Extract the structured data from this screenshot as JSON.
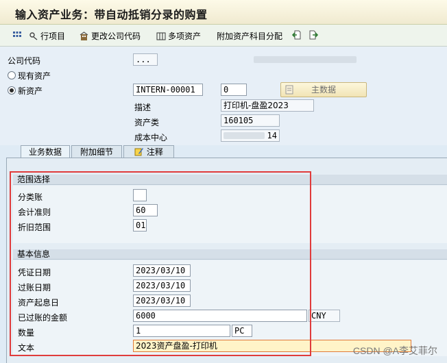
{
  "window": {
    "title": "输入资产业务：带自动抵销分录的购置"
  },
  "toolbar": {
    "line_items_label": "行项目",
    "change_company_label": "更改公司代码",
    "multiple_assets_label": "多项资产",
    "additional_account_assignment_label": "附加资产科目分配"
  },
  "header": {
    "company_code_label": "公司代码",
    "company_code_value": "...",
    "existing_asset_label": "现有资产",
    "new_asset_label": "新资产",
    "asset_number_value": "INTERN-00001",
    "sub_number_value": "0",
    "master_data_button": "主数据",
    "description_label": "描述",
    "description_value": "打印机-盘盈2023",
    "asset_class_label": "资产类",
    "asset_class_value": "160105",
    "cost_center_label": "成本中心",
    "cost_center_value": "14"
  },
  "tabs": [
    {
      "label": "业务数据"
    },
    {
      "label": "附加细节"
    },
    {
      "label": "注释"
    }
  ],
  "scope_group": {
    "title": "范围选择",
    "ledger_label": "分类账",
    "ledger_value": "",
    "accounting_principle_label": "会计准则",
    "accounting_principle_value": "60",
    "depreciation_area_label": "折旧范围",
    "depreciation_area_value": "01"
  },
  "basic_group": {
    "title": "基本信息",
    "document_date_label": "凭证日期",
    "document_date_value": "2023/03/10",
    "posting_date_label": "过账日期",
    "posting_date_value": "2023/03/10",
    "value_date_label": "资产起息日",
    "value_date_value": "2023/03/10",
    "amount_label": "已过账的金额",
    "amount_value": "6000",
    "currency_value": "CNY",
    "quantity_label": "数量",
    "quantity_value": "1",
    "unit_value": "PC",
    "text_label": "文本",
    "text_value": "2023资产盘盈-打印机"
  },
  "watermark": "CSDN @A李艾菲尔",
  "colors": {
    "highlight_box": "#e03b3b",
    "text_field_highlight": "#fff4c8"
  }
}
